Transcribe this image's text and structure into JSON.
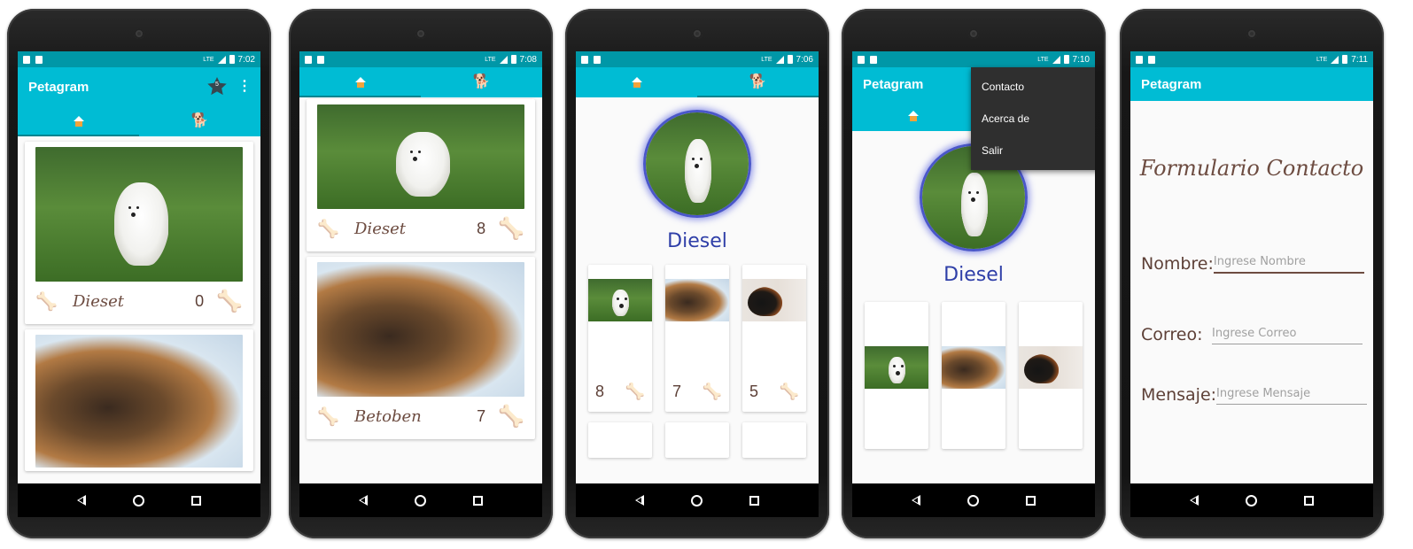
{
  "app": {
    "title": "Petagram"
  },
  "toolbar": {
    "favorites_count": "5",
    "overflow_icon": "more-vert-icon"
  },
  "colors": {
    "primary": "#00bcd4",
    "primary_dark": "#0097a7",
    "accent_bone": "#ef8a2a",
    "name_brown": "#6d4c41",
    "profile_blue": "#2f3fa8"
  },
  "screens": [
    {
      "status_time": "7:02",
      "tabs": [
        "home-icon",
        "dog-icon"
      ],
      "cards": [
        {
          "name": "Dieset",
          "likes": "0",
          "photo": "maltese"
        },
        {
          "name": "",
          "likes": "",
          "photo": "st-bernard"
        }
      ]
    },
    {
      "status_time": "7:08",
      "tabs": [
        "home-icon",
        "dog-icon"
      ],
      "cards": [
        {
          "name": "Dieset",
          "likes": "8",
          "photo": "maltese"
        },
        {
          "name": "Betoben",
          "likes": "7",
          "photo": "st-bernard"
        }
      ]
    },
    {
      "status_time": "7:06",
      "tabs": [
        "home-icon",
        "dog-icon"
      ],
      "profile": {
        "name": "Diesel",
        "grid": [
          {
            "likes": "8",
            "photo": "maltese"
          },
          {
            "likes": "7",
            "photo": "st-bernard"
          },
          {
            "likes": "5",
            "photo": "doberman"
          }
        ]
      }
    },
    {
      "status_time": "7:10",
      "profile": {
        "name": "Diesel"
      },
      "menu": [
        "Contacto",
        "Acerca de",
        "Salir"
      ]
    },
    {
      "status_time": "7:11",
      "form": {
        "title": "Formulario Contacto",
        "fields": [
          {
            "label": "Nombre:",
            "placeholder": "Ingrese Nombre"
          },
          {
            "label": "Correo:",
            "placeholder": "Ingrese Correo"
          },
          {
            "label": "Mensaje:",
            "placeholder": "Ingrese Mensaje"
          }
        ]
      }
    }
  ]
}
